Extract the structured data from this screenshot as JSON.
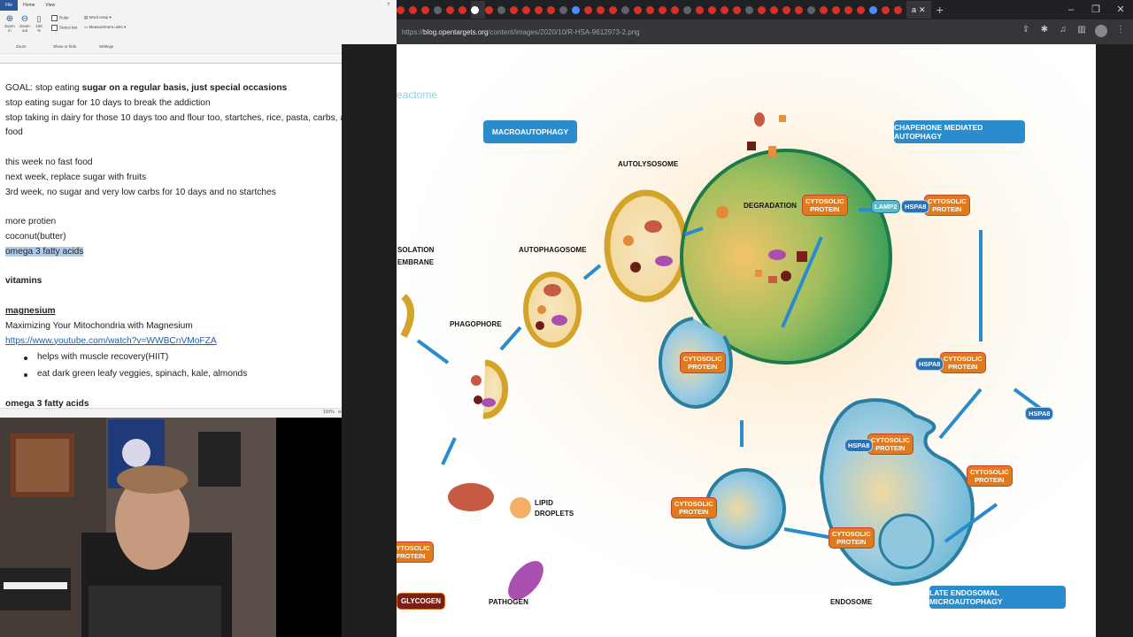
{
  "word": {
    "ribbon_tabs": [
      "File",
      "Home",
      "View"
    ],
    "zoom_group": {
      "zoom_in": "Zoom in",
      "zoom_out": "Zoom out",
      "zoom_pct": "100 %",
      "label": "Zoom"
    },
    "show_hide": {
      "ruler": "Ruler",
      "status_bar": "Status bar",
      "label": "Show or hide"
    },
    "settings": {
      "word_wrap": "Word wrap",
      "measurement": "Measurement units",
      "label": "Settings"
    },
    "status_zoom": "100%",
    "lines": [
      {
        "pre": "GOAL: stop eating ",
        "bold": "sugar on a regular basis, just special occasions"
      },
      "stop eating sugar for 10 days to break the addiction",
      "stop taking in dairy for those 10 days too and flour too, startches, rice, pasta, carbs, all processed",
      "food",
      "",
      "this week no fast food",
      "next week, replace sugar with fruits",
      "3rd week, no sugar and very low carbs for 10 days and no startches",
      "",
      "more protien",
      "coconut(butter)",
      "omega 3 fatty acids",
      "",
      "vitamins",
      "",
      "magnesium",
      "Maximizing Your Mitochondria with Magnesium",
      "https://www.youtube.com/watch?v=WWBCnVMoFZA",
      "helps with muscle recovery(HIIT)",
      "eat dark green leafy veggies, spinach, kale, almonds",
      "",
      "omega 3 fatty acids"
    ]
  },
  "browser": {
    "url_prefix": "https://",
    "url_domain": "blog.opentargets.org",
    "url_path": "/content/images/2020/10/R-HSA-9612973-2.png",
    "tab_title": "a",
    "new_tab": "+",
    "tab_count": 41
  },
  "diagram": {
    "reactome": "eactome",
    "macro": "MACROAUTOPHAGY",
    "cma": "CHAPERONE MEDIATED AUTOPHAGY",
    "leam": "LATE ENDOSOMAL MICROAUTOPHAGY",
    "isolation1": "SOLATION",
    "isolation2": "EMBRANE",
    "phagophore": "PHAGOPHORE",
    "autophagosome": "AUTOPHAGOSOME",
    "autolysosome": "AUTOLYSOSOME",
    "degradation": "DEGRADATION",
    "lipid1": "LIPID",
    "lipid2": "DROPLETS",
    "pathogen": "PATHOGEN",
    "endosome": "ENDOSOME",
    "glycogen": "GLYCOGEN",
    "cyto1": "CYTOSOLIC",
    "cyto2": "PROTEIN",
    "lamp2": "LAMP2",
    "hspa8": "HSPA8",
    "colors": {
      "tag": "#2a8ccd",
      "protein": "#e07a1f",
      "lysosome": "#3f9e5a",
      "vesicle": "#d4a42a",
      "endosome": "#5fb2d6"
    }
  }
}
